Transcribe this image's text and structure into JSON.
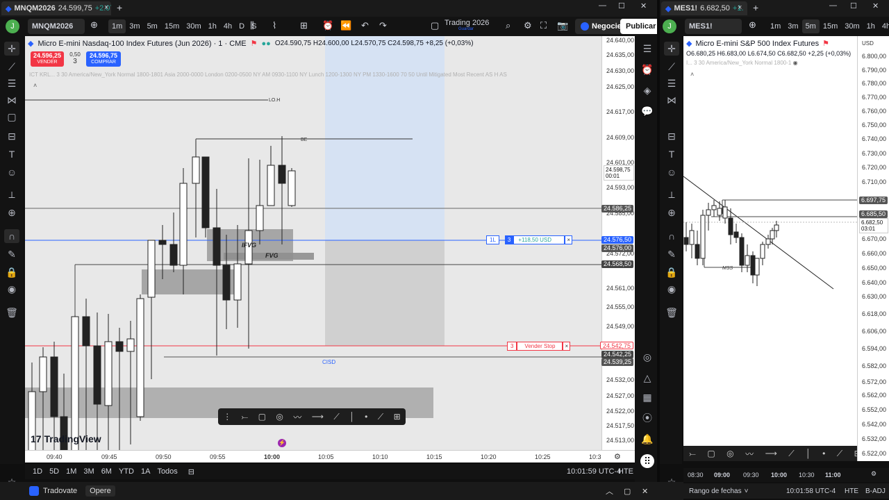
{
  "left_window": {
    "tab_title": "MNQM2026",
    "tab_price": "24.599,75",
    "tab_change": "+2.07",
    "toolbar": {
      "symbol": "MNQM2026",
      "intervals": [
        "1m",
        "3m",
        "5m",
        "15m",
        "30m",
        "1h",
        "4h",
        "D",
        "S"
      ],
      "active_interval": "1m",
      "layout_name": "Trading 2026",
      "layout_sub": "Guardar",
      "trade_button": "Negocie",
      "publish_button": "Publicar"
    },
    "header": {
      "title": "Micro E-mini Nasdaq-100 Index Futures (Jun 2026) · 1 · CME",
      "ohlc": "O24.590,75 H24.600,00 L24.570,75 C24.598,75 +8,25 (+0,03%)",
      "indicator_line": "ICT KRL...  3 30 America/New_York Normal 1800-1801 Asia 2000-0000 London 0200-0500 NY AM 0930-1100 NY Lunch 1200-1300 NY PM 1330-1600 70 50 Until Mitigated Most Recent AS H AS",
      "sell_price": "24.596,25",
      "sell_label": "VENDER",
      "spread": "0,50",
      "qty": "3",
      "buy_price": "24.596,75",
      "buy_label": "COMPRAR"
    },
    "annotations": {
      "loh": "LO.H",
      "be": "BE",
      "ifvg": "IFVG",
      "fvg": "FVG",
      "cisd": "CISD"
    },
    "position_tag": {
      "side": "1L",
      "qty": "3",
      "pnl": "+118,50 USD"
    },
    "stop_tag": {
      "qty": "3",
      "label": "Vender Stop"
    },
    "price_axis": [
      "24.640,00",
      "24.635,00",
      "24.630,00",
      "24.625,00",
      "24.617,00",
      "24.609,00",
      "24.601,00",
      "24.593,00",
      "24.585,00",
      "24.572,00",
      "24.561,00",
      "24.555,00",
      "24.549,00",
      "24.532,00",
      "24.527,00",
      "24.522,00",
      "24.517,50",
      "24.513,00"
    ],
    "price_labels": {
      "current": "24.598,75",
      "countdown": "00:01",
      "l1": "24.586,25",
      "l2": "24.576,50",
      "l3": "24.576,00",
      "l4": "24.568,50",
      "stop": "24.542,75",
      "l5": "24.542,25",
      "l6": "24.539,25"
    },
    "time_axis": [
      "09:40",
      "09:45",
      "09:50",
      "09:55",
      "10:00",
      "10:05",
      "10:10",
      "10:15",
      "10:20",
      "10:25",
      "10:3"
    ],
    "bottom": {
      "ranges": [
        "1D",
        "5D",
        "1M",
        "3M",
        "6M",
        "YTD",
        "1A",
        "Todos"
      ],
      "clock": "10:01:59 UTC-4",
      "tz": "HTE"
    },
    "watermark": "TradingView"
  },
  "right_window": {
    "tab_title": "MES1!",
    "tab_price": "6.682,50",
    "tab_change": "+1.",
    "toolbar": {
      "symbol": "MES1!",
      "intervals": [
        "1m",
        "3m",
        "5m",
        "15m",
        "30m",
        "1h",
        "4h"
      ],
      "active_interval": "5m"
    },
    "header": {
      "title": "Micro E-mini S&P 500 Index Futures",
      "ohlc": "O6.680,25 H6.683,00 L6.674,50 C6.682,50 +2,25 (+0,03%)",
      "indicator_line": "I... 3 30 America/New_York Normal 1800-1"
    },
    "annotations": {
      "mss": "MSS"
    },
    "currency": "USD",
    "price_axis": [
      "6.800,00",
      "6.790,00",
      "6.780,00",
      "6.770,00",
      "6.760,00",
      "6.750,00",
      "6.740,00",
      "6.730,00",
      "6.720,00",
      "6.710,00",
      "6.670,00",
      "6.660,00",
      "6.650,00",
      "6.640,00",
      "6.630,00",
      "6.618,00",
      "6.606,00",
      "6.594,00",
      "6.582,00",
      "6.572,00",
      "6.562,00",
      "6.552,00",
      "6.542,00",
      "6.532,00",
      "6.522,00"
    ],
    "price_labels": {
      "a": "6.697,75",
      "b": "6.685,50",
      "c": "6.682,50",
      "countdown": "03:01"
    },
    "time_axis": [
      "08:30",
      "09:00",
      "09:30",
      "10:00",
      "10:30",
      "11:00"
    ],
    "bottom": {
      "range": "Rango de fechas",
      "clock": "10:01:58 UTC-4",
      "tz": "HTE",
      "adj": "B-ADJ"
    }
  },
  "taskbar": {
    "app1": "Tradovate",
    "app2": "Opere"
  },
  "colors": {
    "bull": "#ffffff",
    "bear": "#222222",
    "blue_line": "#2962ff",
    "red_line": "#f23645",
    "zone_gray": "#9e9e9e",
    "long_box": "#d6e2f3"
  }
}
